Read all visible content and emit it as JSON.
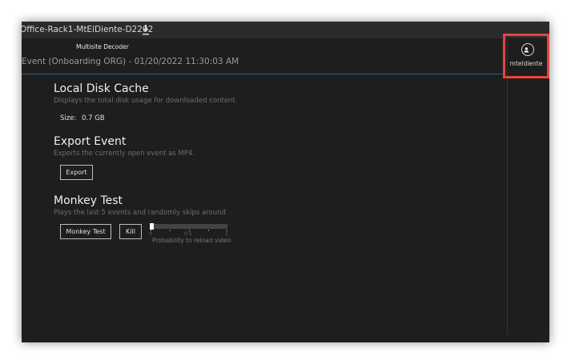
{
  "window": {
    "title": "Office-Rack1-MtElDiente-D2202",
    "app_name": "Multisite Decoder",
    "event_title": "Event (Onboarding ORG) - 01/20/2022 11:30:03 AM"
  },
  "user": {
    "name": "mteldiente",
    "icon": "user-icon",
    "highlight_color": "#e9443c"
  },
  "cache": {
    "title": "Local Disk Cache",
    "description": "Displays the total disk usage for downloaded content.",
    "size_label": "Size:",
    "size_value": "0.7 GB"
  },
  "export": {
    "title": "Export Event",
    "description": "Exports the currently open event as MP4.",
    "button": "Export"
  },
  "monkey": {
    "title": "Monkey Test",
    "description": "Plays the last 5 events and randomly skips around",
    "button": "Monkey Test",
    "kill": "Kill",
    "slider": {
      "label": "Probability to reload video",
      "value": 0,
      "min": 0,
      "max": 1,
      "ticks": [
        "0",
        "0.5",
        "1"
      ]
    }
  }
}
